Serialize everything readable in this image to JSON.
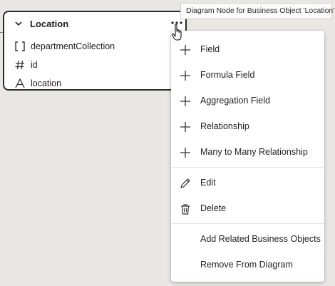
{
  "node": {
    "title": "Location",
    "attributes": [
      {
        "label": "departmentCollection",
        "icon": "collection-icon"
      },
      {
        "label": "id",
        "icon": "number-icon"
      },
      {
        "label": "location",
        "icon": "text-type-icon"
      }
    ]
  },
  "tooltip": {
    "text": "Diagram Node for Business Object 'Location'"
  },
  "menu": {
    "items": [
      {
        "label": "Field",
        "icon": "plus-icon"
      },
      {
        "label": "Formula Field",
        "icon": "plus-icon"
      },
      {
        "label": "Aggregation Field",
        "icon": "plus-icon"
      },
      {
        "label": "Relationship",
        "icon": "plus-icon"
      },
      {
        "label": "Many to Many Relationship",
        "icon": "plus-icon"
      },
      {
        "label": "Edit",
        "icon": "pencil-icon"
      },
      {
        "label": "Delete",
        "icon": "trash-icon"
      },
      {
        "label": "Add Related Business Objects",
        "icon": ""
      },
      {
        "label": "Remove From Diagram",
        "icon": ""
      }
    ]
  }
}
